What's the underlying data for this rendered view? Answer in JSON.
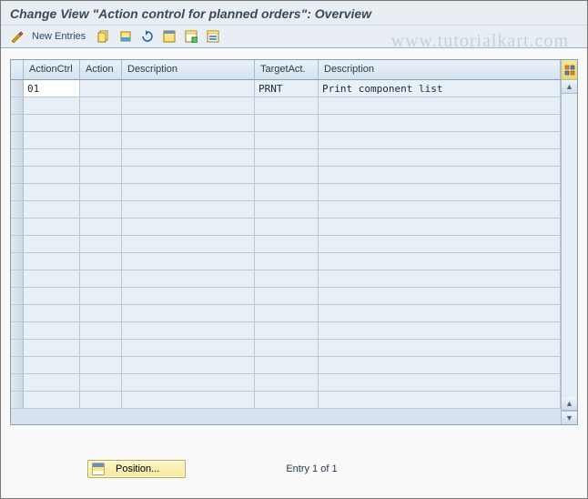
{
  "title": "Change View \"Action control for planned orders\": Overview",
  "toolbar": {
    "new_entries_label": "New Entries"
  },
  "watermark": "www.tutorialkart.com",
  "table": {
    "headers": {
      "action_ctrl": "ActionCtrl",
      "action": "Action",
      "description": "Description",
      "target_act": "TargetAct.",
      "description2": "Description"
    },
    "rows": [
      {
        "action_ctrl": "01",
        "action": "",
        "description": "",
        "target_act": "PRNT",
        "description2": "Print component list"
      },
      {
        "action_ctrl": "",
        "action": "",
        "description": "",
        "target_act": "",
        "description2": ""
      },
      {
        "action_ctrl": "",
        "action": "",
        "description": "",
        "target_act": "",
        "description2": ""
      },
      {
        "action_ctrl": "",
        "action": "",
        "description": "",
        "target_act": "",
        "description2": ""
      },
      {
        "action_ctrl": "",
        "action": "",
        "description": "",
        "target_act": "",
        "description2": ""
      },
      {
        "action_ctrl": "",
        "action": "",
        "description": "",
        "target_act": "",
        "description2": ""
      },
      {
        "action_ctrl": "",
        "action": "",
        "description": "",
        "target_act": "",
        "description2": ""
      },
      {
        "action_ctrl": "",
        "action": "",
        "description": "",
        "target_act": "",
        "description2": ""
      },
      {
        "action_ctrl": "",
        "action": "",
        "description": "",
        "target_act": "",
        "description2": ""
      },
      {
        "action_ctrl": "",
        "action": "",
        "description": "",
        "target_act": "",
        "description2": ""
      },
      {
        "action_ctrl": "",
        "action": "",
        "description": "",
        "target_act": "",
        "description2": ""
      },
      {
        "action_ctrl": "",
        "action": "",
        "description": "",
        "target_act": "",
        "description2": ""
      },
      {
        "action_ctrl": "",
        "action": "",
        "description": "",
        "target_act": "",
        "description2": ""
      },
      {
        "action_ctrl": "",
        "action": "",
        "description": "",
        "target_act": "",
        "description2": ""
      },
      {
        "action_ctrl": "",
        "action": "",
        "description": "",
        "target_act": "",
        "description2": ""
      },
      {
        "action_ctrl": "",
        "action": "",
        "description": "",
        "target_act": "",
        "description2": ""
      },
      {
        "action_ctrl": "",
        "action": "",
        "description": "",
        "target_act": "",
        "description2": ""
      },
      {
        "action_ctrl": "",
        "action": "",
        "description": "",
        "target_act": "",
        "description2": ""
      },
      {
        "action_ctrl": "",
        "action": "",
        "description": "",
        "target_act": "",
        "description2": ""
      }
    ]
  },
  "footer": {
    "position_label": "Position...",
    "entry_text": "Entry 1 of 1"
  }
}
